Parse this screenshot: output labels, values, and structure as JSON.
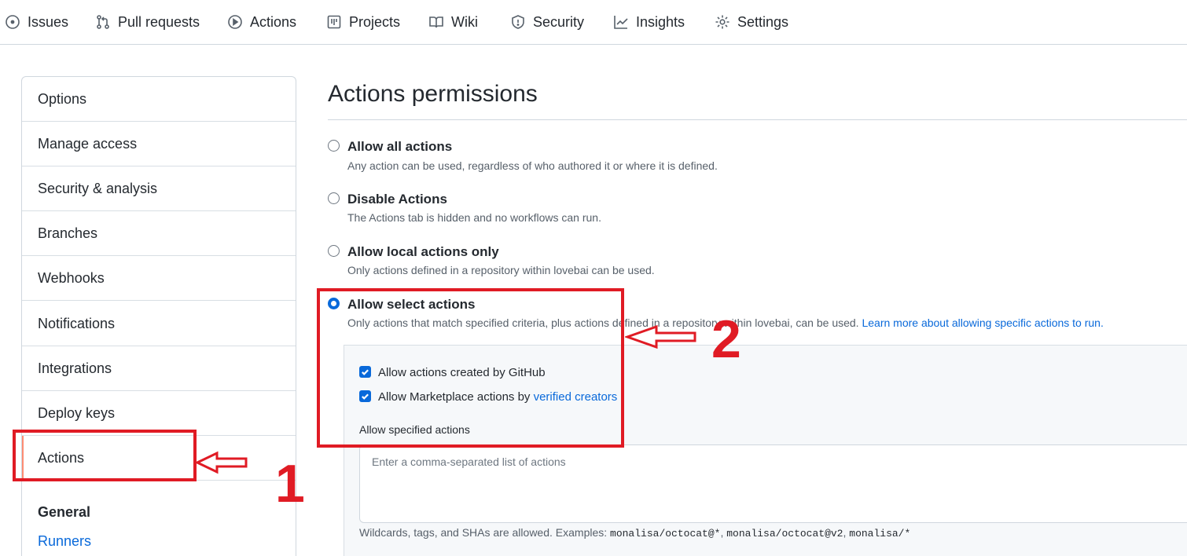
{
  "topnav": {
    "items": [
      {
        "label": "Issues",
        "icon": "issue-opened-icon"
      },
      {
        "label": "Pull requests",
        "icon": "git-pull-request-icon"
      },
      {
        "label": "Actions",
        "icon": "play-icon"
      },
      {
        "label": "Projects",
        "icon": "table-icon"
      },
      {
        "label": "Wiki",
        "icon": "book-icon"
      },
      {
        "label": "Security",
        "icon": "shield-icon"
      },
      {
        "label": "Insights",
        "icon": "graph-icon"
      },
      {
        "label": "Settings",
        "icon": "gear-icon"
      }
    ]
  },
  "sidebar": {
    "items": [
      {
        "label": "Options"
      },
      {
        "label": "Manage access"
      },
      {
        "label": "Security & analysis"
      },
      {
        "label": "Branches"
      },
      {
        "label": "Webhooks"
      },
      {
        "label": "Notifications"
      },
      {
        "label": "Integrations"
      },
      {
        "label": "Deploy keys"
      },
      {
        "label": "Actions",
        "selected": true
      }
    ],
    "section_heading": "General",
    "section_link": "Runners"
  },
  "main": {
    "title": "Actions permissions",
    "options": [
      {
        "label": "Allow all actions",
        "description": "Any action can be used, regardless of who authored it or where it is defined.",
        "checked": false
      },
      {
        "label": "Disable Actions",
        "description": "The Actions tab is hidden and no workflows can run.",
        "checked": false
      },
      {
        "label": "Allow local actions only",
        "description": "Only actions defined in a repository within lovebai can be used.",
        "checked": false
      },
      {
        "label": "Allow select actions",
        "description": "Only actions that match specified criteria, plus actions defined in a repository within lovebai, can be used.",
        "link": "Learn more about allowing specific actions to run.",
        "checked": true
      }
    ],
    "select_panel": {
      "checkbox_github": "Allow actions created by GitHub",
      "checkbox_marketplace_prefix": "Allow Marketplace actions by",
      "checkbox_marketplace_link": "verified creators",
      "specified_label": "Allow specified actions",
      "input_value": "",
      "input_placeholder": "Enter a comma-separated list of actions",
      "hint_prefix": "Wildcards, tags, and SHAs are allowed. Examples:",
      "hint_examples": [
        "monalisa/octocat@*",
        "monalisa/octocat@v2",
        "monalisa/*"
      ]
    }
  },
  "annotations": {
    "marker_1": "1",
    "marker_2": "2",
    "color": "#e01b24"
  },
  "colors": {
    "accent": "#0969da",
    "selected_border": "#fd8c73",
    "text": "#24292f",
    "muted": "#57606a"
  }
}
